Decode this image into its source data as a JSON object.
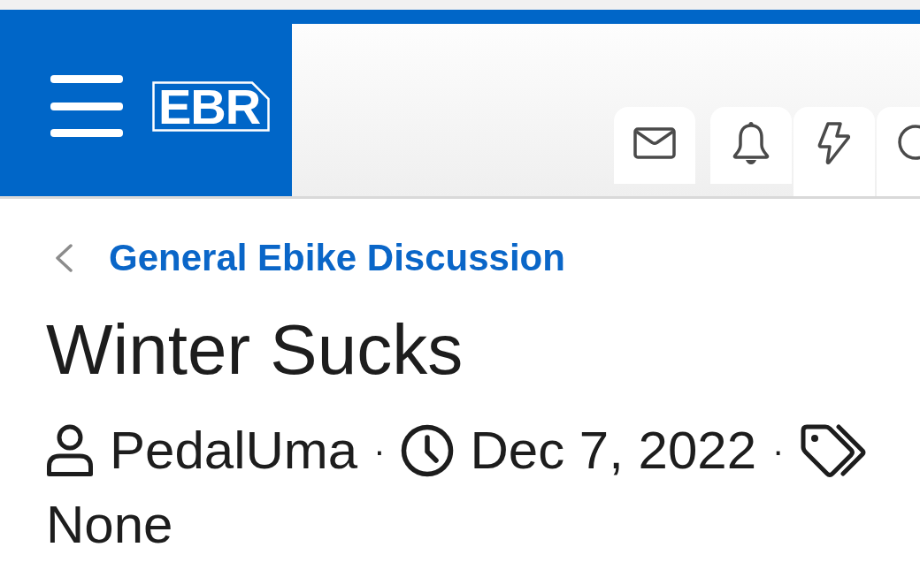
{
  "header": {
    "logo": "EBR"
  },
  "breadcrumb": {
    "label": "General Ebike Discussion"
  },
  "thread": {
    "title": "Winter Sucks",
    "meta": [
      {
        "kind": "author",
        "text": "PedalUma"
      },
      {
        "kind": "separator",
        "text": "·"
      },
      {
        "kind": "date",
        "text": "Dec 7, 2022"
      },
      {
        "kind": "separator",
        "text": "·"
      },
      {
        "kind": "tags",
        "text": "None"
      }
    ]
  }
}
